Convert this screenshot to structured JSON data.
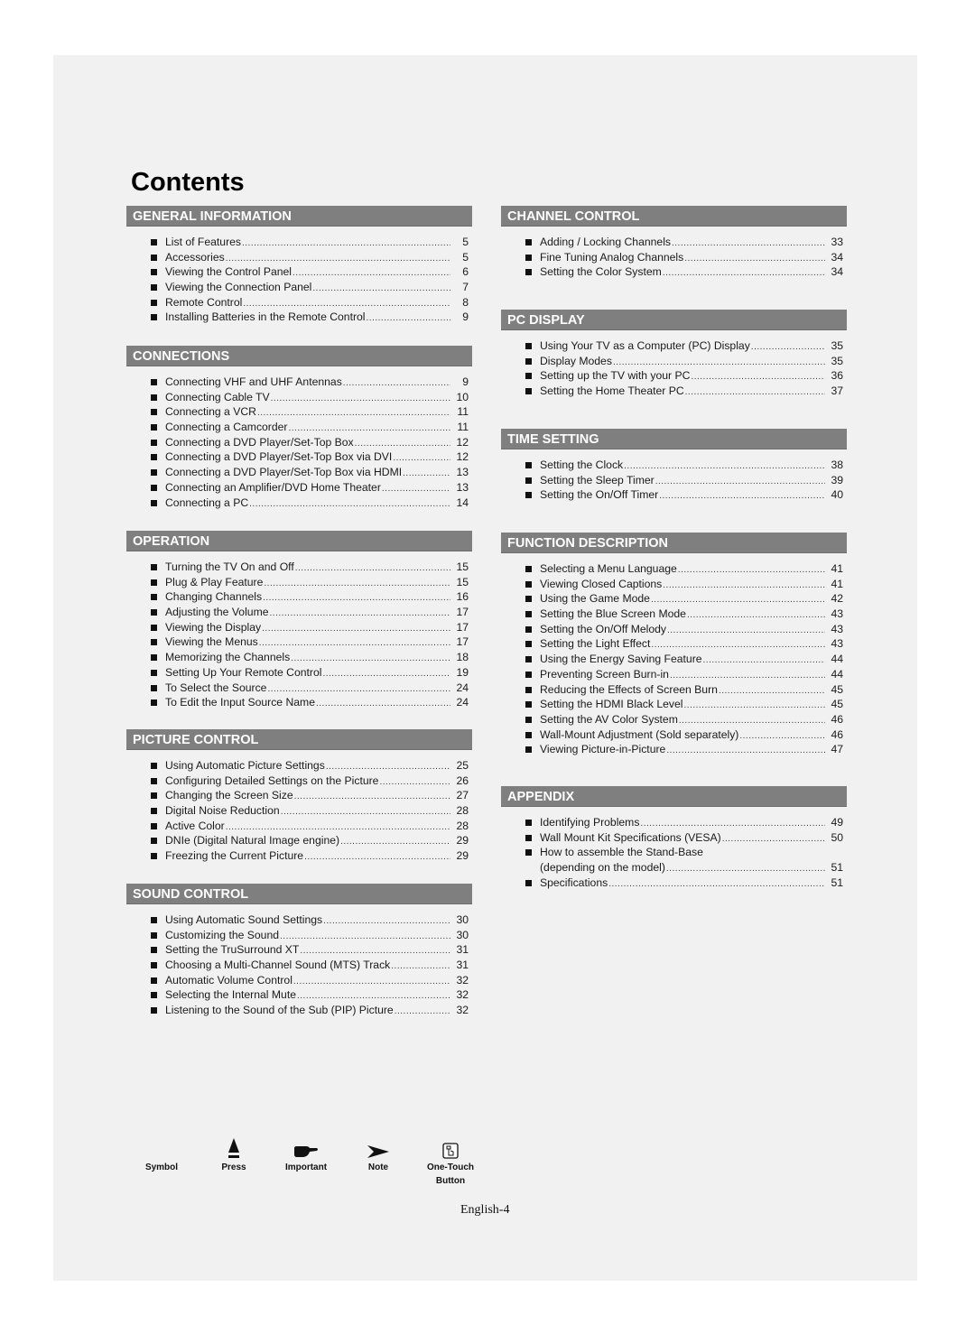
{
  "page": {
    "title": "Contents",
    "footer": "English-4"
  },
  "left_column": [
    {
      "heading": "GENERAL INFORMATION",
      "items": [
        {
          "label": "List of Features",
          "page": "5"
        },
        {
          "label": "Accessories",
          "page": "5"
        },
        {
          "label": "Viewing the Control Panel",
          "page": "6"
        },
        {
          "label": "Viewing the Connection Panel",
          "page": "7"
        },
        {
          "label": "Remote Control",
          "page": "8"
        },
        {
          "label": "Installing Batteries in the Remote Control",
          "page": "9"
        }
      ]
    },
    {
      "heading": "CONNECTIONS",
      "items": [
        {
          "label": "Connecting VHF and UHF Antennas",
          "page": "9"
        },
        {
          "label": "Connecting Cable TV",
          "page": "10"
        },
        {
          "label": "Connecting a VCR",
          "page": "11"
        },
        {
          "label": "Connecting a Camcorder",
          "page": "11"
        },
        {
          "label": "Connecting a DVD Player/Set-Top Box",
          "page": "12"
        },
        {
          "label": "Connecting a DVD Player/Set-Top Box via DVI",
          "page": "12"
        },
        {
          "label": "Connecting a DVD Player/Set-Top Box via HDMI",
          "page": "13"
        },
        {
          "label": "Connecting an Amplifier/DVD Home Theater",
          "page": "13"
        },
        {
          "label": "Connecting a PC",
          "page": "14"
        }
      ]
    },
    {
      "heading": "OPERATION",
      "items": [
        {
          "label": "Turning the TV On and Off",
          "page": "15"
        },
        {
          "label": "Plug & Play Feature",
          "page": "15"
        },
        {
          "label": "Changing Channels",
          "page": "16"
        },
        {
          "label": "Adjusting the Volume",
          "page": "17"
        },
        {
          "label": "Viewing the Display",
          "page": "17"
        },
        {
          "label": "Viewing the Menus",
          "page": "17"
        },
        {
          "label": "Memorizing the Channels",
          "page": "18"
        },
        {
          "label": "Setting Up Your Remote Control",
          "page": "19"
        },
        {
          "label": "To Select the Source",
          "page": "24"
        },
        {
          "label": "To Edit the Input Source Name",
          "page": "24"
        }
      ]
    },
    {
      "heading": "PICTURE CONTROL",
      "items": [
        {
          "label": "Using Automatic Picture Settings",
          "page": "25"
        },
        {
          "label": "Configuring Detailed Settings on the Picture",
          "page": "26"
        },
        {
          "label": "Changing the Screen Size",
          "page": "27"
        },
        {
          "label": "Digital Noise Reduction",
          "page": "28"
        },
        {
          "label": "Active Color",
          "page": "28"
        },
        {
          "label": "DNIe (Digital Natural Image engine)",
          "page": "29"
        },
        {
          "label": "Freezing the Current Picture",
          "page": "29"
        }
      ]
    },
    {
      "heading": "SOUND CONTROL",
      "items": [
        {
          "label": "Using Automatic Sound Settings",
          "page": "30"
        },
        {
          "label": "Customizing the Sound",
          "page": "30"
        },
        {
          "label": "Setting the TruSurround XT",
          "page": "31"
        },
        {
          "label": "Choosing a Multi-Channel Sound (MTS) Track",
          "page": "31"
        },
        {
          "label": "Automatic Volume Control",
          "page": "32"
        },
        {
          "label": "Selecting the Internal Mute",
          "page": "32"
        },
        {
          "label": "Listening to the Sound of the Sub (PIP) Picture",
          "page": "32"
        }
      ]
    }
  ],
  "right_column": [
    {
      "heading": "CHANNEL CONTROL",
      "items": [
        {
          "label": "Adding / Locking Channels",
          "page": "33"
        },
        {
          "label": "Fine Tuning Analog Channels",
          "page": "34"
        },
        {
          "label": "Setting the Color System",
          "page": "34"
        }
      ]
    },
    {
      "heading": "PC DISPLAY",
      "items": [
        {
          "label": "Using Your TV as a Computer (PC) Display",
          "page": "35"
        },
        {
          "label": "Display Modes",
          "page": "35"
        },
        {
          "label": "Setting up the TV with your PC",
          "page": "36"
        },
        {
          "label": "Setting the Home Theater PC",
          "page": "37"
        }
      ]
    },
    {
      "heading": "TIME SETTING",
      "items": [
        {
          "label": "Setting the Clock",
          "page": "38"
        },
        {
          "label": "Setting the Sleep Timer",
          "page": "39"
        },
        {
          "label": "Setting the On/Off Timer",
          "page": "40"
        }
      ]
    },
    {
      "heading": "FUNCTION DESCRIPTION",
      "items": [
        {
          "label": "Selecting a Menu Language",
          "page": "41"
        },
        {
          "label": "Viewing Closed Captions",
          "page": "41"
        },
        {
          "label": "Using the Game Mode",
          "page": "42"
        },
        {
          "label": "Setting the Blue Screen Mode",
          "page": "43"
        },
        {
          "label": "Setting the On/Off Melody",
          "page": "43"
        },
        {
          "label": "Setting the Light Effect",
          "page": "43"
        },
        {
          "label": "Using the Energy Saving Feature",
          "page": "44"
        },
        {
          "label": "Preventing Screen Burn-in",
          "page": "44"
        },
        {
          "label": "Reducing the Effects of Screen Burn",
          "page": "45"
        },
        {
          "label": "Setting the HDMI Black Level",
          "page": "45"
        },
        {
          "label": "Setting the AV Color System",
          "page": "46"
        },
        {
          "label": "Wall-Mount Adjustment (Sold separately)",
          "page": "46"
        },
        {
          "label": "Viewing Picture-in-Picture",
          "page": "47"
        }
      ]
    },
    {
      "heading": "APPENDIX",
      "items": [
        {
          "label": "Identifying Problems",
          "page": "49"
        },
        {
          "label": "Wall Mount Kit Specifications (VESA)",
          "page": "50"
        },
        {
          "label": "How to assemble the Stand-Base",
          "page": "",
          "continued": "(depending on the model)",
          "continued_page": "51"
        },
        {
          "label": "Specifications",
          "page": "51"
        }
      ]
    }
  ],
  "legend": {
    "items": [
      {
        "label": "Symbol",
        "icon": "none"
      },
      {
        "label": "Press",
        "icon": "press-triangle-icon"
      },
      {
        "label": "Important",
        "icon": "pointing-hand-icon"
      },
      {
        "label": "Note",
        "icon": "note-arrow-icon"
      },
      {
        "label": "One-Touch Button",
        "icon": "one-touch-button-icon"
      }
    ]
  },
  "colors": {
    "page_background": "#f1f1f1",
    "section_header_bg": "#7f7f7f",
    "section_header_text": "#ffffff"
  }
}
